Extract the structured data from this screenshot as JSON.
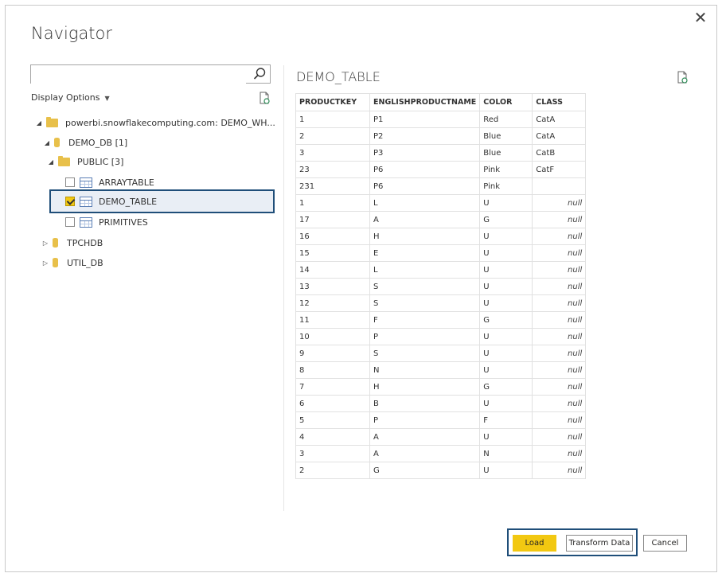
{
  "dialog": {
    "title": "Navigator",
    "close_glyph": "✕"
  },
  "left_pane": {
    "search": {
      "placeholder": "",
      "value": ""
    },
    "display_options_label": "Display Options",
    "tree": [
      {
        "label": "powerbi.snowflakecomputing.com: DEMO_WH...",
        "type": "server",
        "expanded": true
      },
      {
        "label": "DEMO_DB [1]",
        "type": "database",
        "expanded": true
      },
      {
        "label": "PUBLIC [3]",
        "type": "schema",
        "expanded": true
      },
      {
        "label": "ARRAYTABLE",
        "type": "table",
        "checked": false
      },
      {
        "label": "DEMO_TABLE",
        "type": "table",
        "checked": true,
        "selected": true
      },
      {
        "label": "PRIMITIVES",
        "type": "table",
        "checked": false
      },
      {
        "label": "TPCHDB",
        "type": "database",
        "expanded": false
      },
      {
        "label": "UTIL_DB",
        "type": "database",
        "expanded": false
      }
    ]
  },
  "preview": {
    "title": "DEMO_TABLE",
    "columns": [
      "PRODUCTKEY",
      "ENGLISHPRODUCTNAME",
      "COLOR",
      "CLASS"
    ],
    "rows": [
      [
        "1",
        "P1",
        "Red",
        "CatA"
      ],
      [
        "2",
        "P2",
        "Blue",
        "CatA"
      ],
      [
        "3",
        "P3",
        "Blue",
        "CatB"
      ],
      [
        "23",
        "P6",
        "Pink",
        "CatF"
      ],
      [
        "231",
        "P6",
        "Pink",
        ""
      ],
      [
        "1",
        "L",
        "U",
        "null"
      ],
      [
        "17",
        "A",
        "G",
        "null"
      ],
      [
        "16",
        "H",
        "U",
        "null"
      ],
      [
        "15",
        "E",
        "U",
        "null"
      ],
      [
        "14",
        "L",
        "U",
        "null"
      ],
      [
        "13",
        "S",
        "U",
        "null"
      ],
      [
        "12",
        "S",
        "U",
        "null"
      ],
      [
        "11",
        "F",
        "G",
        "null"
      ],
      [
        "10",
        "P",
        "U",
        "null"
      ],
      [
        "9",
        "S",
        "U",
        "null"
      ],
      [
        "8",
        "N",
        "U",
        "null"
      ],
      [
        "7",
        "H",
        "G",
        "null"
      ],
      [
        "6",
        "B",
        "U",
        "null"
      ],
      [
        "5",
        "P",
        "F",
        "null"
      ],
      [
        "4",
        "A",
        "U",
        "null"
      ],
      [
        "3",
        "A",
        "N",
        "null"
      ],
      [
        "2",
        "G",
        "U",
        "null"
      ]
    ]
  },
  "footer": {
    "load_label": "Load",
    "transform_label": "Transform Data",
    "cancel_label": "Cancel"
  },
  "colors": {
    "accent_yellow": "#f2c811",
    "highlight_border": "#1f4e79",
    "folder": "#e8c04a"
  }
}
